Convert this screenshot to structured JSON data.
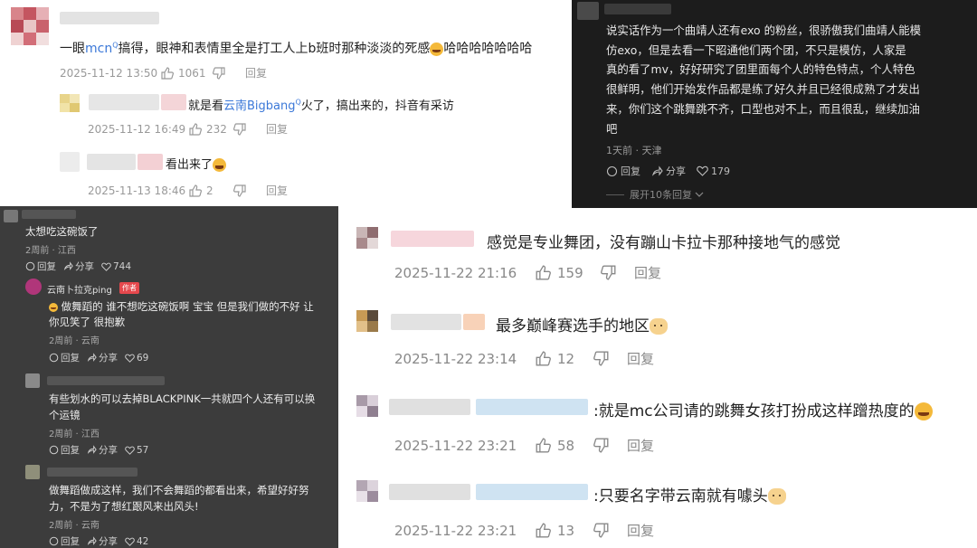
{
  "panel_a": {
    "c1": {
      "text_pre": "一眼",
      "link": "mcn",
      "text_post": "搞得，眼神和表情里全是打工人上b班时那种淡淡的死感",
      "text_tail": "哈哈哈哈哈哈哈",
      "date": "2025-11-12 13:50",
      "likes": "1061",
      "reply": "回复"
    },
    "c2": {
      "text_pre": "就是看",
      "link": "云南Bigbang",
      "text_post": "火了，搞出来的，抖音有采访",
      "date": "2025-11-12 16:49",
      "likes": "232",
      "reply": "回复"
    },
    "c3": {
      "text": "看出来了",
      "date": "2025-11-13 18:46",
      "likes": "2",
      "reply": "回复"
    }
  },
  "panel_b": {
    "lines": [
      "说实话作为一个曲靖人还有exo 的粉丝，很骄傲我们曲靖人能模",
      "仿exo，但是去看一下昭通他们两个团，不只是模仿，人家是",
      "真的看了mv，好好研究了团里面每个人的特色特点，个人特色",
      "很鲜明，他们开始发作品都是练了好久并且已经很成熟了才发出",
      "来，你们这个跳舞跳不齐，口型也对不上，而且很乱，继续加油",
      "吧"
    ],
    "meta": "1天前 · 天津",
    "reply": "回复",
    "share": "分享",
    "likes": "179",
    "expand": "展开10条回复"
  },
  "panel_c": {
    "c1": {
      "text": "太想吃这碗饭了",
      "meta": "2周前 · 江西",
      "reply": "回复",
      "share": "分享",
      "likes": "744"
    },
    "author": {
      "name": "云南卜拉克ping",
      "badge": "作者",
      "line1": "做舞蹈的 谁不想吃这碗饭啊 宝宝 但是我们做的不好 让",
      "line2": "你见笑了 很抱歉",
      "meta": "2周前 · 云南",
      "reply": "回复",
      "share": "分享",
      "likes": "69"
    },
    "c3": {
      "line1": "有些划水的可以去掉BLACKPINK一共就四个人还有可以换",
      "line2": "个运镜",
      "meta": "2周前 · 江西",
      "reply": "回复",
      "share": "分享",
      "likes": "57"
    },
    "c4": {
      "line1": "做舞蹈做成这样，我们不会舞蹈的都看出来，希望好好努",
      "line2": "力，不是为了想红跟风来出风头!",
      "meta": "2周前 · 云南",
      "reply": "回复",
      "share": "分享",
      "likes": "42"
    }
  },
  "panel_d": {
    "c1": {
      "text": "感觉是专业舞团，没有蹦山卡拉卡那种接地气的感觉",
      "date": "2025-11-22 21:16",
      "likes": "159",
      "reply": "回复"
    },
    "c2": {
      "text": "最多巅峰赛选手的地区",
      "date": "2025-11-22 23:14",
      "likes": "12",
      "reply": "回复"
    },
    "c3": {
      "text": ":就是mc公司请的跳舞女孩打扮成这样蹭热度的",
      "date": "2025-11-22 23:21",
      "likes": "58",
      "reply": "回复"
    },
    "c4": {
      "text": ":只要名字带云南就有噱头",
      "date": "2025-11-22 23:21",
      "likes": "13",
      "reply": "回复"
    }
  },
  "icons": [
    "thumbs-up-icon",
    "thumbs-down-icon",
    "share-icon",
    "heart-icon",
    "reply-icon",
    "chevron-down-icon"
  ],
  "colors": {
    "link": "#3b78d8",
    "dark_panel": "#1c1c1c",
    "gray_panel": "#3c3c3c",
    "author_badge": "#e5484d"
  }
}
